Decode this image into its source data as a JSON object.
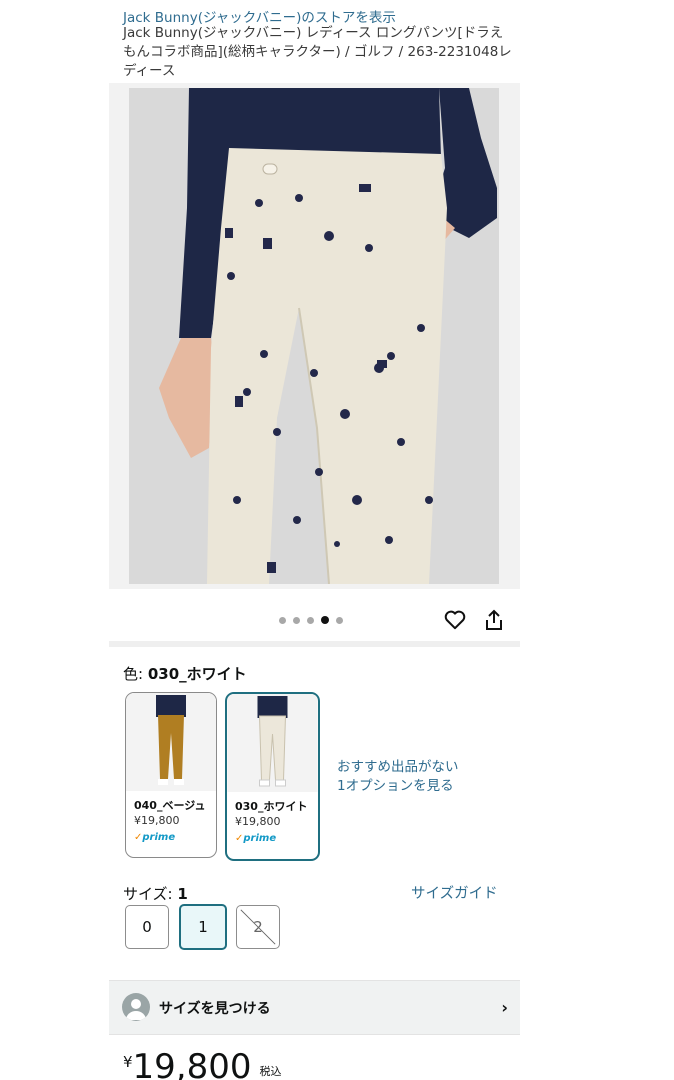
{
  "header": {
    "store_link": "Jack Bunny(ジャックバニー)のストアを表示",
    "product_title": "Jack Bunny(ジャックバニー) レディース ロングパンツ[ドラえもんコラボ商品](総柄キャラクター) / ゴルフ / 263-2231048レディース"
  },
  "gallery": {
    "dot_count": 5,
    "active_index": 3,
    "icons": {
      "favorite": "heart-icon",
      "share": "share-icon"
    }
  },
  "color": {
    "label": "色: ",
    "selected": "030_ホワイト",
    "options": [
      {
        "name": "040_ベージュ",
        "price": "¥19,800",
        "prime": "prime",
        "selected": false
      },
      {
        "name": "030_ホワイト",
        "price": "¥19,800",
        "prime": "prime",
        "selected": true
      }
    ],
    "no_offer_line1": "おすすめ出品がない",
    "no_offer_line2": "1オプションを見る"
  },
  "size": {
    "label": "サイズ: ",
    "selected": "1",
    "guide": "サイズガイド",
    "options": [
      {
        "label": "0",
        "state": "available"
      },
      {
        "label": "1",
        "state": "selected"
      },
      {
        "label": "2",
        "state": "unavailable"
      }
    ]
  },
  "find_size": {
    "label": "サイズを見つける"
  },
  "price": {
    "currency": "¥",
    "amount": "19,800",
    "tax": "税込"
  },
  "colors": {
    "link": "#2F6C8F",
    "selected_border": "#1f6f80",
    "prime": "#1399c6"
  }
}
